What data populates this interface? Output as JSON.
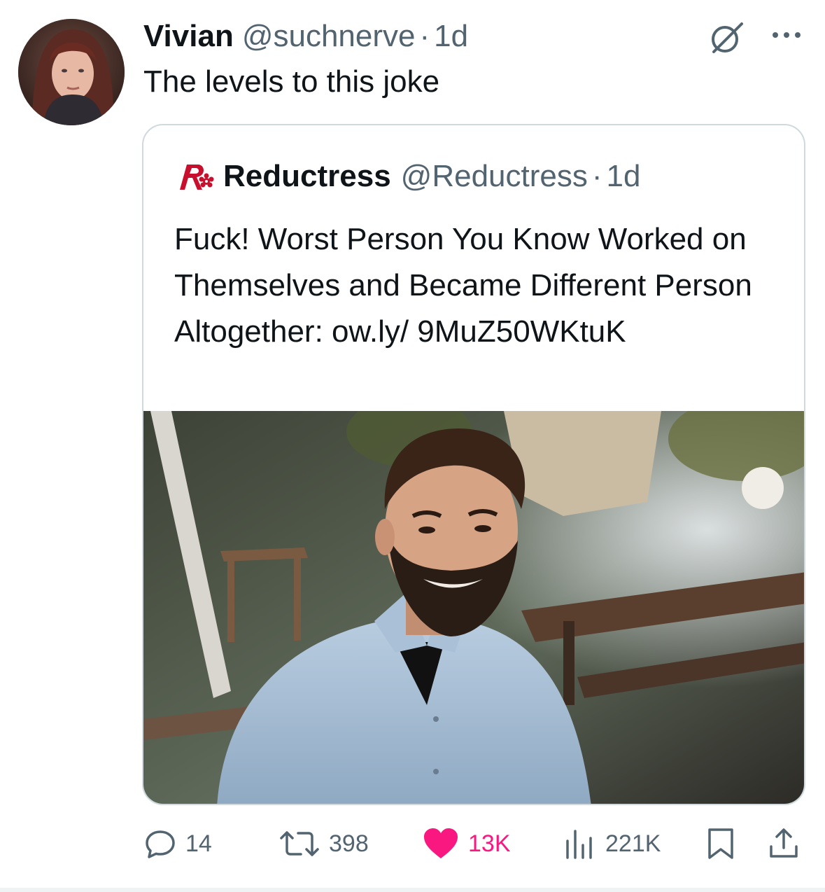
{
  "tweet": {
    "author_name": "Vivian",
    "author_handle": "@suchnerve",
    "separator": "·",
    "time": "1d",
    "text": "The levels to this joke"
  },
  "quote": {
    "author_name": "Reductress",
    "author_handle": "@Reductress",
    "separator": "·",
    "time": "1d",
    "text": "Fuck! Worst Person You Know Worked on Themselves and Became Different Person Altogether: ow.ly/ 9MuZ50WKtuK"
  },
  "stats": {
    "replies": "14",
    "reposts": "398",
    "likes": "13K",
    "views": "221K"
  },
  "icons": {
    "grok": "grok-slash-circle-icon",
    "more": "more-dots-icon",
    "reply": "reply-bubble-icon",
    "repost": "repost-arrows-icon",
    "like": "heart-filled-icon",
    "views": "bar-chart-icon",
    "bookmark": "bookmark-icon",
    "share": "share-upload-icon"
  },
  "colors": {
    "text_primary": "#0f1419",
    "text_secondary": "#536471",
    "like_pink": "#f91880",
    "card_border": "#cfd9de",
    "reductress_red": "#c8102e"
  }
}
